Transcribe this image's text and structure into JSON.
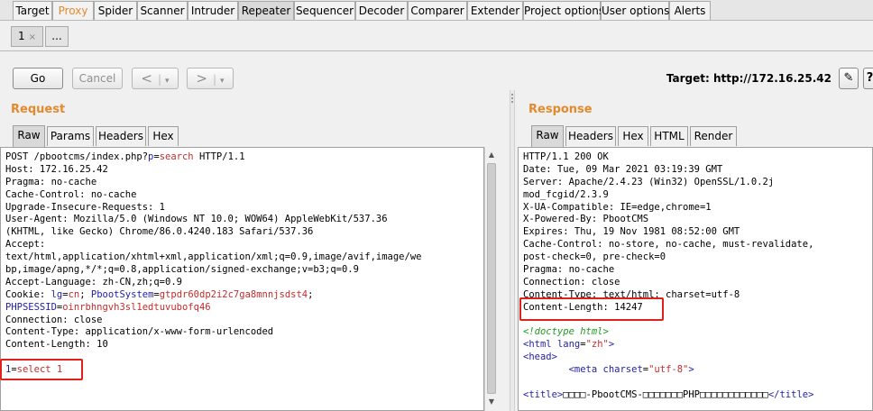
{
  "top_tabs": [
    "Target",
    "Proxy",
    "Spider",
    "Scanner",
    "Intruder",
    "Repeater",
    "Sequencer",
    "Decoder",
    "Comparer",
    "Extender",
    "Project options",
    "User options",
    "Alerts"
  ],
  "sub_tabs": {
    "first": "1",
    "close": "×",
    "more": "..."
  },
  "toolbar": {
    "go": "Go",
    "cancel": "Cancel",
    "back": "<",
    "back_drop": "▾",
    "forward": ">",
    "forward_drop": "▾",
    "target": "Target: http://172.16.25.42",
    "edit_icon": "✎",
    "help_icon": "?"
  },
  "request": {
    "title": "Request",
    "tabs": [
      "Raw",
      "Params",
      "Headers",
      "Hex"
    ],
    "lines": [
      [
        {
          "t": "POST /pbootcms/index.php?"
        },
        {
          "t": "p",
          "c": "k"
        },
        {
          "t": "="
        },
        {
          "t": "search",
          "c": "v"
        },
        {
          "t": " HTTP/1.1"
        }
      ],
      [
        {
          "t": "Host: 172.16.25.42"
        }
      ],
      [
        {
          "t": "Pragma: no-cache"
        }
      ],
      [
        {
          "t": "Cache-Control: no-cache"
        }
      ],
      [
        {
          "t": "Upgrade-Insecure-Requests: 1"
        }
      ],
      [
        {
          "t": "User-Agent: Mozilla/5.0 (Windows NT 10.0; WOW64) AppleWebKit/537.36"
        }
      ],
      [
        {
          "t": "(KHTML, like Gecko) Chrome/86.0.4240.183 Safari/537.36"
        }
      ],
      [
        {
          "t": "Accept:"
        }
      ],
      [
        {
          "t": "text/html,application/xhtml+xml,application/xml;q=0.9,image/avif,image/we"
        }
      ],
      [
        {
          "t": "bp,image/apng,*/*;q=0.8,application/signed-exchange;v=b3;q=0.9"
        }
      ],
      [
        {
          "t": "Accept-Language: zh-CN,zh;q=0.9"
        }
      ],
      [
        {
          "t": "Cookie: "
        },
        {
          "t": "lg",
          "c": "k"
        },
        {
          "t": "="
        },
        {
          "t": "cn",
          "c": "v"
        },
        {
          "t": "; "
        },
        {
          "t": "PbootSystem",
          "c": "k"
        },
        {
          "t": "="
        },
        {
          "t": "gtpdr60dp2i2c7ga8mnnjsdst4",
          "c": "v"
        },
        {
          "t": ";"
        }
      ],
      [
        {
          "t": "PHPSESSID",
          "c": "k"
        },
        {
          "t": "="
        },
        {
          "t": "oinrbhngvh3sl1edtuvubofq46",
          "c": "v"
        }
      ],
      [
        {
          "t": "Connection: close"
        }
      ],
      [
        {
          "t": "Content-Type: application/x-www-form-urlencoded"
        }
      ],
      [
        {
          "t": "Content-Length: 10"
        }
      ],
      [
        {
          "t": ""
        }
      ],
      [
        {
          "t": "1",
          "c": "k"
        },
        {
          "t": "="
        },
        {
          "t": "select 1",
          "c": "v"
        }
      ]
    ]
  },
  "response": {
    "title": "Response",
    "tabs": [
      "Raw",
      "Headers",
      "Hex",
      "HTML",
      "Render"
    ],
    "lines": [
      [
        {
          "t": "HTTP/1.1 200 OK"
        }
      ],
      [
        {
          "t": "Date: Tue, 09 Mar 2021 03:19:39 GMT"
        }
      ],
      [
        {
          "t": "Server: Apache/2.4.23 (Win32) OpenSSL/1.0.2j"
        }
      ],
      [
        {
          "t": "mod_fcgid/2.3.9"
        }
      ],
      [
        {
          "t": "X-UA-Compatible: IE=edge,chrome=1"
        }
      ],
      [
        {
          "t": "X-Powered-By: PbootCMS"
        }
      ],
      [
        {
          "t": "Expires: Thu, 19 Nov 1981 08:52:00 GMT"
        }
      ],
      [
        {
          "t": "Cache-Control: no-store, no-cache, must-revalidate,"
        }
      ],
      [
        {
          "t": "post-check=0, pre-check=0"
        }
      ],
      [
        {
          "t": "Pragma: no-cache"
        }
      ],
      [
        {
          "t": "Connection: close"
        }
      ],
      [
        {
          "t": "Content-Type: text/html; charset=utf-8"
        }
      ],
      [
        {
          "t": "Content-Length: 14247"
        }
      ],
      [
        {
          "t": ""
        }
      ],
      [
        {
          "t": "<!doctype html>",
          "c": "doc"
        }
      ],
      [
        {
          "t": "<html ",
          "c": "tag"
        },
        {
          "t": "lang",
          "c": "k"
        },
        {
          "t": "="
        },
        {
          "t": "\"zh\"",
          "c": "v"
        },
        {
          "t": ">",
          "c": "tag"
        }
      ],
      [
        {
          "t": "<head>",
          "c": "tag"
        }
      ],
      [
        {
          "t": "        "
        },
        {
          "t": "<meta ",
          "c": "tag"
        },
        {
          "t": "charset",
          "c": "k"
        },
        {
          "t": "="
        },
        {
          "t": "\"utf-8\"",
          "c": "v"
        },
        {
          "t": ">",
          "c": "tag"
        }
      ],
      [
        {
          "t": ""
        }
      ],
      [
        {
          "t": "<title>",
          "c": "tag"
        },
        {
          "t": "□□□□-PbootCMS-□□□□□□□PHP□□□□□□□□□□□□"
        },
        {
          "t": "</title>",
          "c": "tag"
        }
      ]
    ]
  }
}
